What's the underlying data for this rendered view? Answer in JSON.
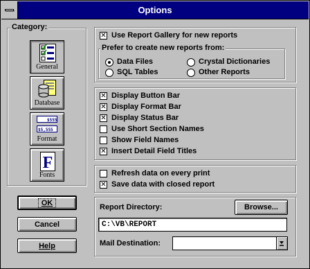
{
  "window": {
    "title": "Options"
  },
  "category": {
    "legend": "Category:",
    "items": [
      {
        "label": "General",
        "icon": "general-checklist-icon",
        "selected": true
      },
      {
        "label": "Database",
        "icon": "database-icon",
        "selected": false
      },
      {
        "label": "Format",
        "icon": "format-icon",
        "selected": false
      },
      {
        "label": "Fonts",
        "icon": "fonts-icon",
        "selected": false
      }
    ]
  },
  "buttons": {
    "ok": "OK",
    "cancel": "Cancel",
    "help": "Help"
  },
  "gallery": {
    "use_gallery": {
      "label": "Use Report Gallery for new reports",
      "checked": true
    },
    "prefer_legend": "Prefer to create new reports from:",
    "sources": [
      {
        "label": "Data Files",
        "selected": true
      },
      {
        "label": "Crystal Dictionaries",
        "selected": false
      },
      {
        "label": "SQL Tables",
        "selected": false
      },
      {
        "label": "Other Reports",
        "selected": false
      }
    ]
  },
  "display": [
    {
      "label": "Display Button Bar",
      "checked": true
    },
    {
      "label": "Display Format Bar",
      "checked": true
    },
    {
      "label": "Display Status Bar",
      "checked": true
    },
    {
      "label": "Use Short Section Names",
      "checked": false
    },
    {
      "label": "Show Field Names",
      "checked": false
    },
    {
      "label": "Insert Detail Field Titles",
      "checked": true
    }
  ],
  "data_options": [
    {
      "label": "Refresh data on every print",
      "checked": false
    },
    {
      "label": "Save data with closed report",
      "checked": true
    }
  ],
  "directory": {
    "label": "Report Directory:",
    "browse": "Browse...",
    "value": "C:\\VB\\REPORT",
    "mail_label": "Mail Destination:",
    "mail_value": ""
  },
  "colors": {
    "title_bar": "#000080",
    "face": "#c0c0c0"
  }
}
